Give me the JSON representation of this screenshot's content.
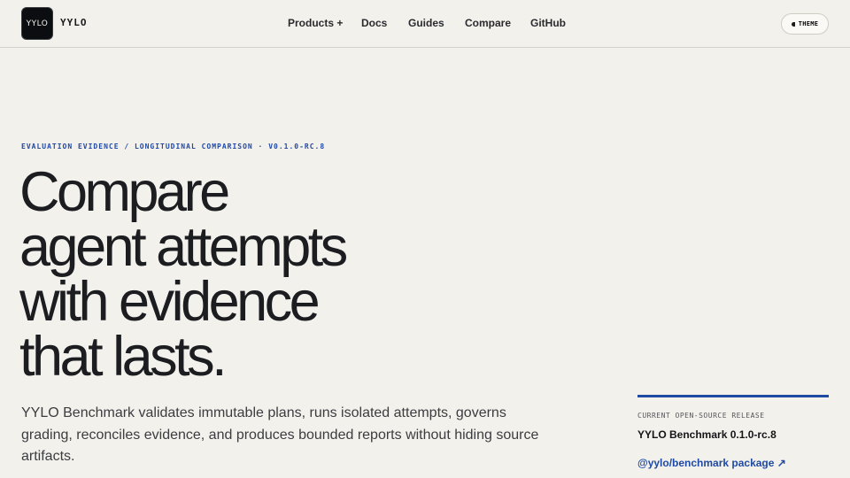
{
  "header": {
    "logo_text": "YYLO",
    "brand_name": "YYLO",
    "nav": [
      {
        "label": "Products +"
      },
      {
        "label": "Docs"
      },
      {
        "label": "Guides"
      },
      {
        "label": "Compare"
      },
      {
        "label": "GitHub"
      }
    ],
    "theme_button": {
      "label": "THEME",
      "icon": "half-moon-icon"
    }
  },
  "hero": {
    "eyebrow": "EVALUATION EVIDENCE / LONGITUDINAL COMPARISON · V0.1.0-RC.8",
    "headline_lines": [
      "Compare",
      "agent attempts",
      "with evidence",
      "that lasts."
    ],
    "lede": "YYLO Benchmark validates immutable plans, runs isolated attempts, governs grading, reconciles evidence, and produces bounded reports without hiding source artifacts."
  },
  "release": {
    "kicker": "CURRENT OPEN-SOURCE RELEASE",
    "title": "YYLO Benchmark 0.1.0-rc.8",
    "link_label": "@yylo/benchmark package ↗"
  },
  "colors": {
    "background": "#f3f1ec",
    "accent": "#1f4aa3",
    "text": "#1b1c1f"
  }
}
